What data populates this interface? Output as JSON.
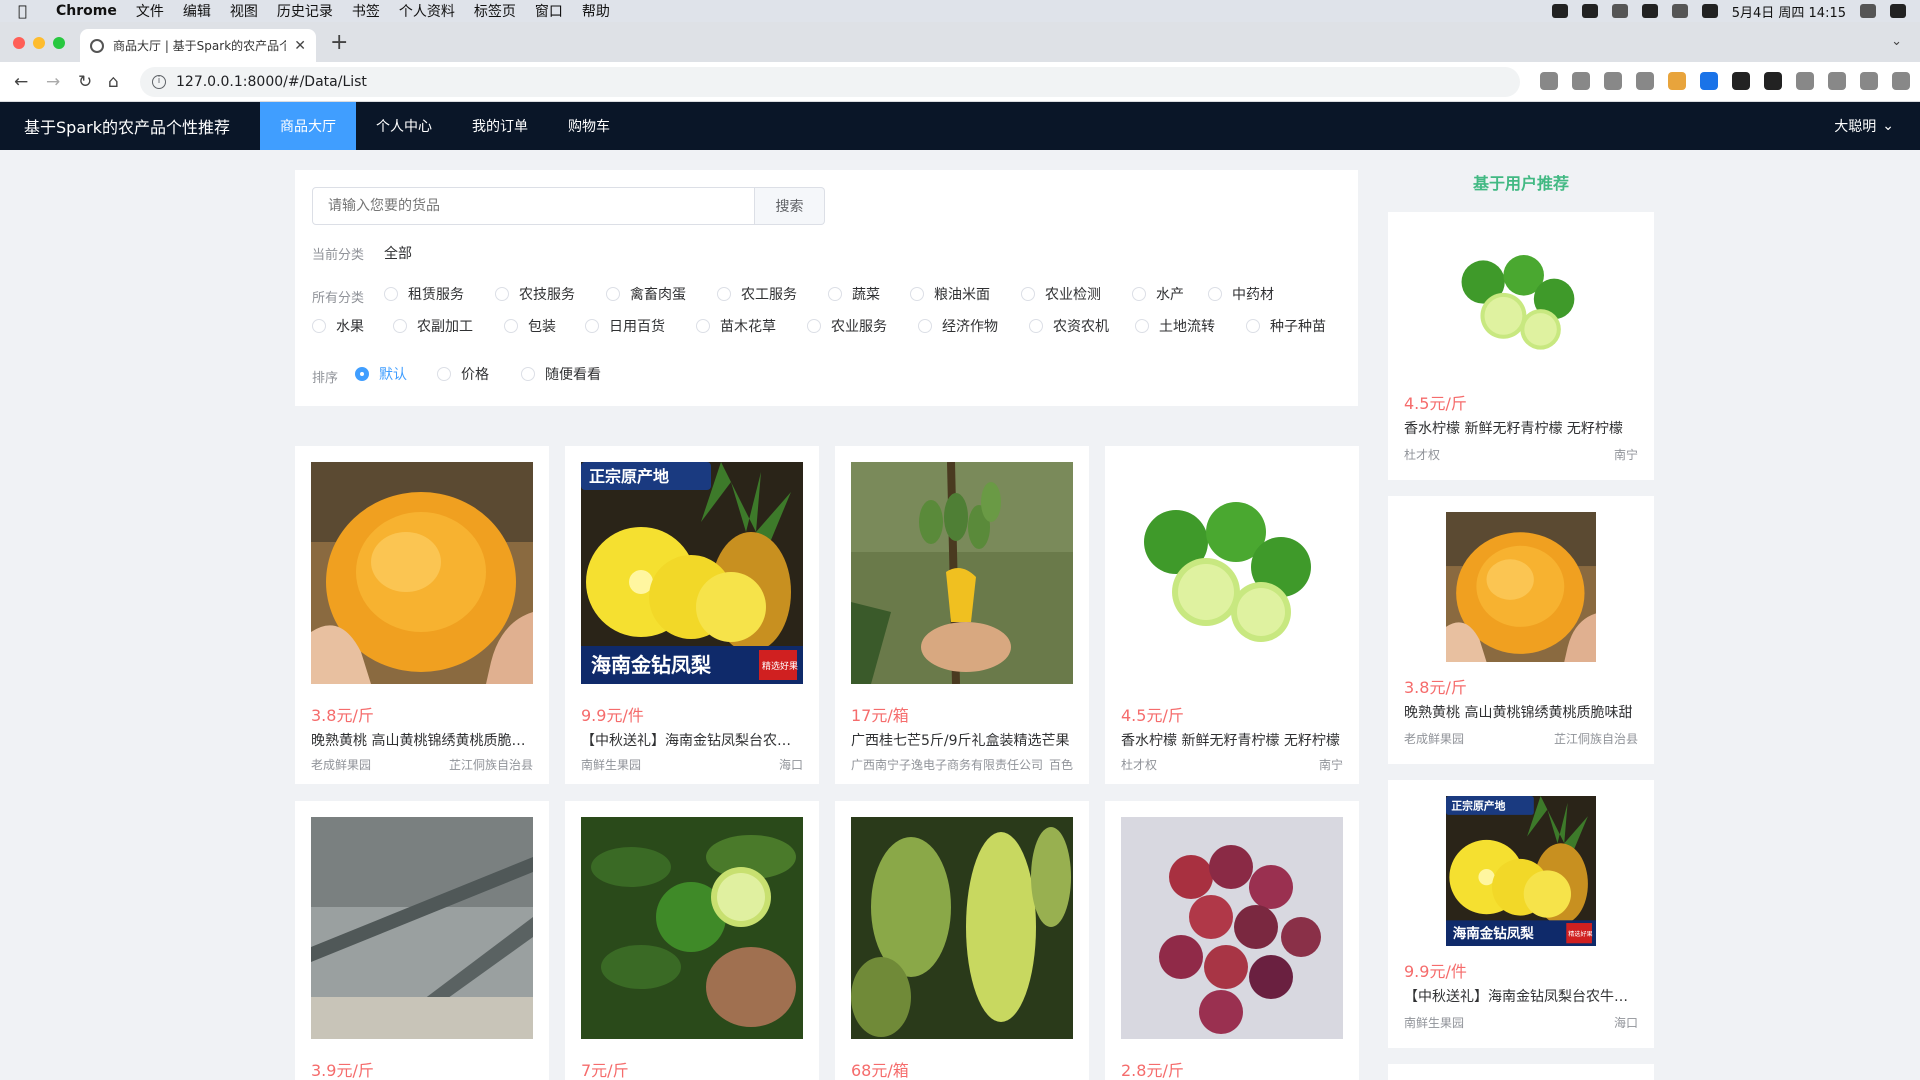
{
  "mac_menubar": {
    "app": "Chrome",
    "items": [
      "文件",
      "编辑",
      "视图",
      "历史记录",
      "书签",
      "个人资料",
      "标签页",
      "窗口",
      "帮助"
    ],
    "clock": "5月4日 周四 14:15"
  },
  "browser": {
    "tab_title": "商品大厅 | 基于Spark的农产品个性化推荐",
    "url": "127.0.0.1:8000/#/Data/List"
  },
  "nav": {
    "brand": "基于Spark的农产品个性推荐",
    "items": [
      "商品大厅",
      "个人中心",
      "我的订单",
      "购物车"
    ],
    "user": "大聪明"
  },
  "filter": {
    "search_placeholder": "请输入您要的货品",
    "search_button": "搜索",
    "current_label": "当前分类",
    "current_value": "全部",
    "all_label": "所有分类",
    "categories": [
      "租赁服务",
      "农技服务",
      "禽畜肉蛋",
      "农工服务",
      "蔬菜",
      "粮油米面",
      "农业检测",
      "水产",
      "中药材",
      "水果",
      "农副加工",
      "包装",
      "日用百货",
      "苗木花草",
      "农业服务",
      "经济作物",
      "农资农机",
      "土地流转",
      "种子种苗"
    ],
    "sort_label": "排序",
    "sort_options": [
      "默认",
      "价格",
      "随便看看"
    ],
    "sort_selected": "默认"
  },
  "products": [
    {
      "price": "3.8元/斤",
      "name": "晚熟黄桃 高山黄桃锦绣黄桃质脆味甜",
      "seller": "老成鲜果园",
      "region": "芷江侗族自治县"
    },
    {
      "price": "9.9元/件",
      "name": "【中秋送礼】海南金钻凤梨台农牛奶菠萝",
      "seller": "南鲜生果园",
      "region": "海口",
      "img_text_top": "正宗原产地",
      "img_text_bottom": "海南金钻凤梨",
      "img_badge": "精选好果"
    },
    {
      "price": "17元/箱",
      "name": "广西桂七芒5斤/9斤礼盒装精选芒果",
      "seller": "广西南宁子逸电子商务有限责任公司",
      "region": "百色"
    },
    {
      "price": "4.5元/斤",
      "name": "香水柠檬 新鲜无籽青柠檬 无籽柠檬",
      "seller": "杜才权",
      "region": "南宁"
    },
    {
      "price": "3.9元/斤",
      "name": "",
      "seller": "",
      "region": ""
    },
    {
      "price": "7元/斤",
      "name": "",
      "seller": "",
      "region": ""
    },
    {
      "price": "68元/箱",
      "name": "",
      "seller": "",
      "region": ""
    },
    {
      "price": "2.8元/斤",
      "name": "",
      "seller": "",
      "region": ""
    }
  ],
  "recommend": {
    "title": "基于用户推荐",
    "items": [
      {
        "price": "4.5元/斤",
        "name": "香水柠檬 新鲜无籽青柠檬 无籽柠檬",
        "seller": "杜才权",
        "region": "南宁"
      },
      {
        "price": "3.8元/斤",
        "name": "晚熟黄桃 高山黄桃锦绣黄桃质脆味甜",
        "seller": "老成鲜果园",
        "region": "芷江侗族自治县"
      },
      {
        "price": "9.9元/件",
        "name": "【中秋送礼】海南金钻凤梨台农牛奶菠萝",
        "seller": "南鲜生果园",
        "region": "海口",
        "img_text_top": "正宗原产地",
        "img_text_bottom": "海南金钻凤梨",
        "img_badge": "精选好果"
      }
    ]
  },
  "colors": {
    "nav_bg": "#0a1628",
    "nav_active": "#409eff",
    "price": "#f56c6c",
    "rec_title": "#42b983"
  }
}
